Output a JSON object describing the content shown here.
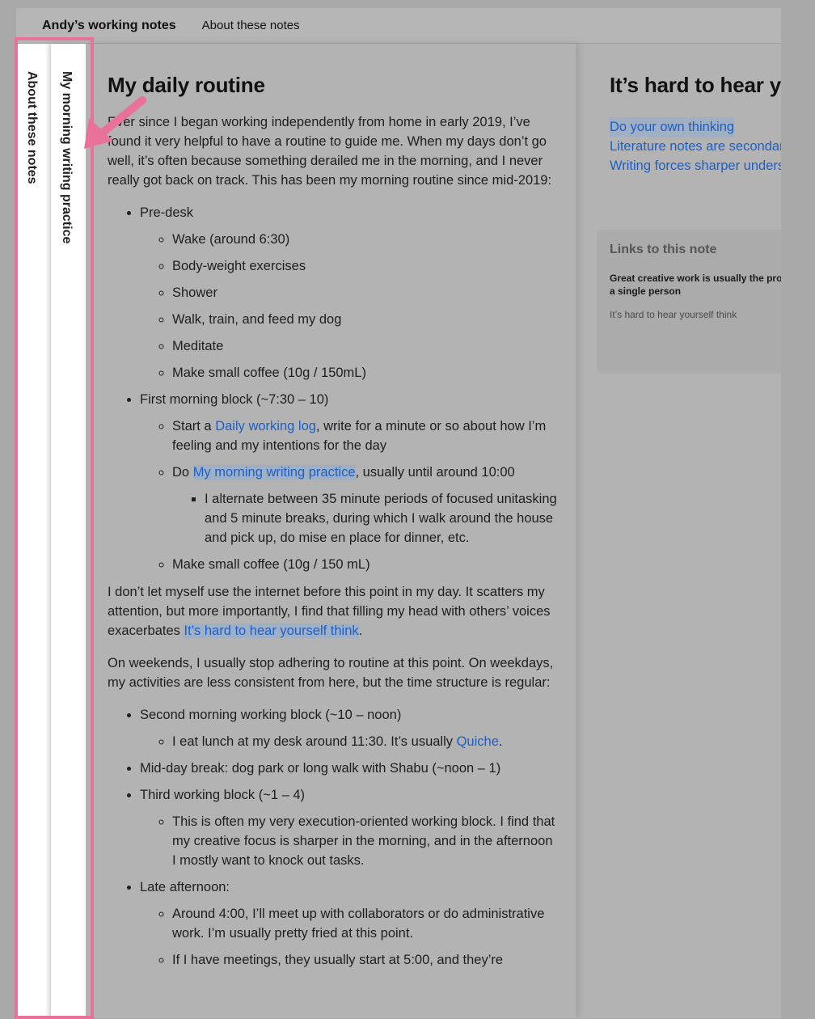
{
  "topbar": {
    "brand": "Andy’s working notes",
    "about_link": "About these notes"
  },
  "stack": {
    "spine1_label": "About these notes",
    "spine2_label": "My morning writing practice"
  },
  "note": {
    "title": "My daily routine",
    "intro": "Ever since I began working independently from home in early 2019, I’ve found it very helpful to have a routine to guide me. When my days don’t go well, it’s often because something derailed me in the morning, and I never really got back on track. This has been my morning routine since mid-2019:",
    "predesk": {
      "label": "Pre-desk",
      "items": [
        "Wake (around 6:30)",
        "Body-weight exercises",
        "Shower",
        "Walk, train, and feed my dog",
        "Meditate",
        "Make small coffee (10g / 150mL)"
      ]
    },
    "first_block": {
      "label": "First morning block (~7:30 – 10)",
      "log_pre": "Start a ",
      "log_link": "Daily working log",
      "log_post": ", write for a minute or so about how I’m feeling and my intentions for the day",
      "do_pre": "Do ",
      "do_link": "My morning writing practice",
      "do_post": ", usually until around 10:00",
      "sub": "I alternate between 35 minute periods of focused unitasking and 5 minute breaks, during which I walk around the house and pick up, do mise en place for dinner, etc.",
      "coffee": "Make small coffee (10g / 150 mL)"
    },
    "internet_pre": "I don’t let myself use the internet before this point in my day. It scatters my attention, but more importantly, I find that filling my head with others’ voices exacerbates ",
    "internet_link": "It’s hard to hear yourself think",
    "internet_post": ".",
    "weekends": "On weekends, I usually stop adhering to routine at this point. On weekdays, my activities are less consistent from here, but the time structure is regular:",
    "second_block": {
      "label": "Second morning working block (~10 – noon)",
      "lunch_pre": "I eat lunch at my desk around 11:30. It’s usually ",
      "lunch_link": "Quiche",
      "lunch_post": "."
    },
    "midday": "Mid-day break: dog park or long walk with Shabu (~noon – 1)",
    "third_block": {
      "label": "Third working block (~1 – 4)",
      "sub": "This is often my very execution-oriented working block. I find that my creative focus is sharper in the morning, and in the afternoon I mostly want to knock out tasks."
    },
    "late": {
      "label": "Late afternoon:",
      "items": [
        "Around 4:00, I’ll meet up with collaborators or do administrative work. I’m usually pretty fried at this point.",
        "If I have meetings, they usually start at 5:00, and they’re"
      ]
    }
  },
  "side_note": {
    "title": "It’s hard to hear yourself think",
    "links": [
      "Do your own thinking",
      "Literature notes are secondary",
      "Writing forces sharper understanding"
    ],
    "backlinks_title": "Links to this note",
    "backlink1": "Great creative work is usually the product of a single person",
    "backlink2": "It’s hard to hear yourself think"
  },
  "colors": {
    "highlight": "#e8729a",
    "link": "#1d5fc7"
  }
}
